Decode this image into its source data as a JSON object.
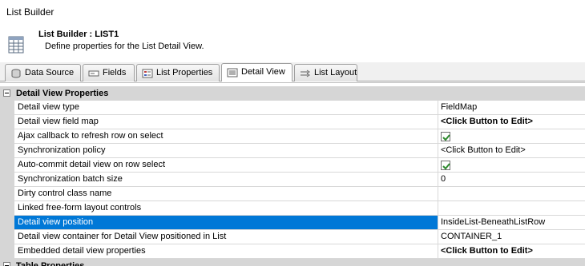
{
  "window": {
    "title": "List Builder"
  },
  "header": {
    "title": "List Builder : LIST1",
    "description": "Define properties for the List Detail View."
  },
  "tabs": [
    {
      "label": "Data Source",
      "icon": "database-icon",
      "active": false
    },
    {
      "label": "Fields",
      "icon": "field-icon",
      "active": false
    },
    {
      "label": "List Properties",
      "icon": "properties-icon",
      "active": false
    },
    {
      "label": "Detail View",
      "icon": "detail-view-icon",
      "active": true
    },
    {
      "label": "List Layout",
      "icon": "layout-icon",
      "active": false
    }
  ],
  "sections": {
    "detail": "Detail View Properties",
    "table": "Table Properties"
  },
  "properties": [
    {
      "name": "Detail view type",
      "value": "FieldMap",
      "kind": "text"
    },
    {
      "name": "Detail view field map",
      "value": "<Click Button to Edit>",
      "kind": "bold"
    },
    {
      "name": "Ajax callback to refresh row on select",
      "value": "",
      "kind": "checkbox",
      "checked": true
    },
    {
      "name": "Synchronization policy",
      "value": "<Click Button to Edit>",
      "kind": "text"
    },
    {
      "name": "Auto-commit detail view on row select",
      "value": "",
      "kind": "checkbox",
      "checked": true
    },
    {
      "name": "Synchronization batch size",
      "value": "0",
      "kind": "text"
    },
    {
      "name": "Dirty control class name",
      "value": "",
      "kind": "text"
    },
    {
      "name": "Linked free-form layout controls",
      "value": "",
      "kind": "text"
    },
    {
      "name": "Detail view position",
      "value": "InsideList-BeneathListRow",
      "kind": "text",
      "selected": true
    },
    {
      "name": "Detail view container for Detail View positioned in List",
      "value": "CONTAINER_1",
      "kind": "text"
    },
    {
      "name": "Embedded detail view properties",
      "value": "<Click Button to Edit>",
      "kind": "bold"
    }
  ],
  "colors": {
    "selection": "#0078d7",
    "gutter": "#d6d6d6",
    "check": "#2e8b2e"
  }
}
